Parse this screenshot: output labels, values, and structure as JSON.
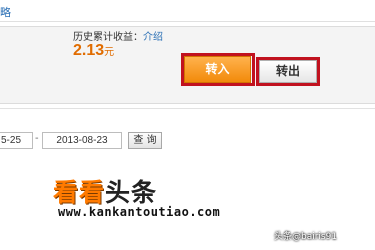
{
  "topbar": {
    "link_text": "略"
  },
  "income": {
    "label": "历史累计收益：",
    "intro_link": "介绍",
    "value": "2.13",
    "unit": "元"
  },
  "buttons": {
    "transfer_in": "转入",
    "transfer_out": "转出"
  },
  "filter": {
    "date_from": "5-25",
    "separator": "-",
    "date_to": "2013-08-23",
    "query_label": "查 询"
  },
  "watermark": {
    "logo_part1": "看看",
    "logo_part2": "头条",
    "url": "www.kankantoutiao.com",
    "corner_text": "头条@bairis91"
  },
  "colors": {
    "accent_orange": "#f28a0a",
    "highlight_red": "#c1121f",
    "link_blue": "#2a6fb5"
  }
}
